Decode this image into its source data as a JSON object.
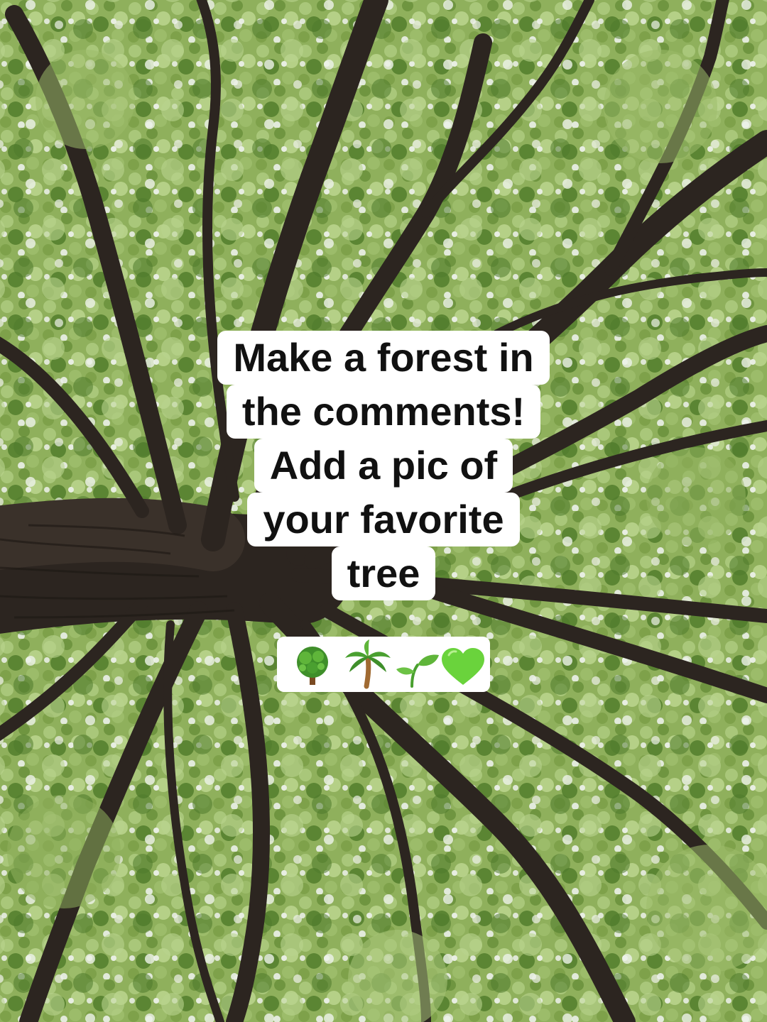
{
  "overlay": {
    "lines": [
      "Make a forest in",
      "the comments!",
      "Add a pic of",
      "your favorite",
      "tree"
    ],
    "emojis": [
      "deciduous-tree-icon",
      "palm-tree-icon",
      "seedling-icon",
      "green-heart-icon"
    ]
  },
  "colors": {
    "caption_bg": "#ffffff",
    "caption_text": "#111111",
    "leaf_light": "#a9c77a",
    "leaf_dark": "#4e7a2c",
    "branch": "#2c2520",
    "sky": "#e4eadf"
  }
}
